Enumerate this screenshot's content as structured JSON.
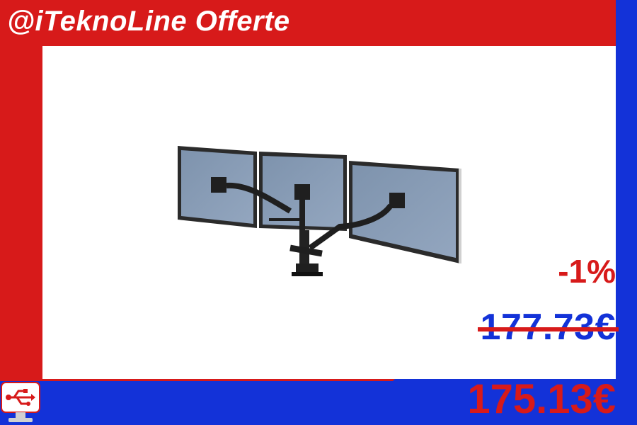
{
  "brand": {
    "text": "@iTeknoLine Offerte"
  },
  "offer": {
    "discount": "-1%",
    "old_price": "177.73€",
    "new_price": "175.13€"
  },
  "icons": {
    "logo": "usb-monitor-logo-icon",
    "product": "triple-monitor-arm-image"
  },
  "colors": {
    "red": "#d71a1a",
    "blue": "#1332d8",
    "white": "#ffffff"
  }
}
